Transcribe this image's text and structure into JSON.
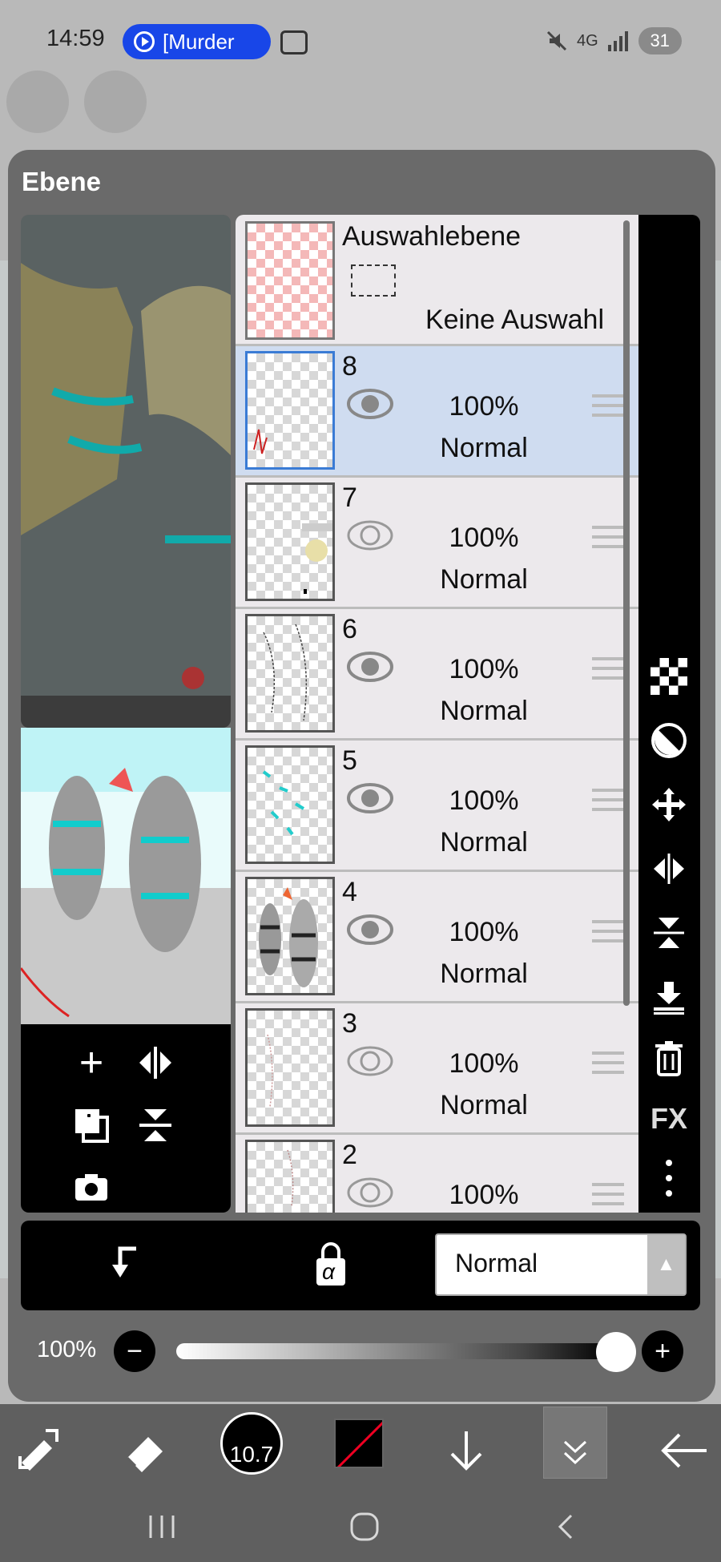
{
  "status_bar": {
    "time": "14:59",
    "recording_label": "[Murder",
    "network": "4G",
    "battery": "31"
  },
  "panel": {
    "title": "Ebene"
  },
  "selection_layer": {
    "name": "Auswahlebene",
    "status": "Keine Auswahl"
  },
  "layers": [
    {
      "number": "8",
      "opacity": "100%",
      "blend": "Normal",
      "visible": true,
      "active": true
    },
    {
      "number": "7",
      "opacity": "100%",
      "blend": "Normal",
      "visible": false,
      "active": false
    },
    {
      "number": "6",
      "opacity": "100%",
      "blend": "Normal",
      "visible": true,
      "active": false
    },
    {
      "number": "5",
      "opacity": "100%",
      "blend": "Normal",
      "visible": true,
      "active": false
    },
    {
      "number": "4",
      "opacity": "100%",
      "blend": "Normal",
      "visible": true,
      "active": false
    },
    {
      "number": "3",
      "opacity": "100%",
      "blend": "Normal",
      "visible": false,
      "active": false
    },
    {
      "number": "2",
      "opacity": "100%",
      "blend": "",
      "visible": false,
      "active": false
    }
  ],
  "side_tools": {
    "fx_label": "FX"
  },
  "bottom_bar": {
    "blend_mode": "Normal",
    "alpha_lock_glyph": "α"
  },
  "opacity": {
    "label": "100%",
    "value": 1.0
  },
  "toolbar": {
    "brush_size": "10.7"
  },
  "colors": {
    "panel": "#6a6a6a",
    "active_layer": "#cfdcf0",
    "accent_blue": "#1846e8"
  }
}
